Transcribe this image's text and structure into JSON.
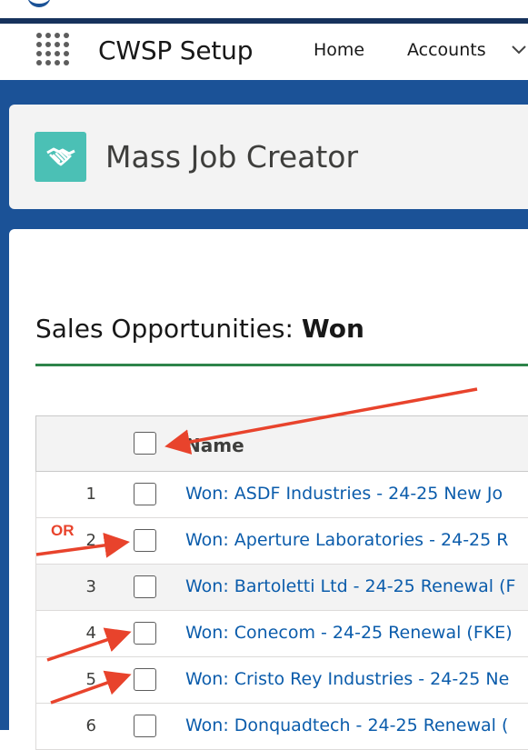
{
  "navbar": {
    "app_name": "CWSP Setup",
    "items": [
      {
        "label": "Home"
      },
      {
        "label": "Accounts"
      }
    ]
  },
  "header": {
    "title": "Mass Job Creator",
    "icon": "handshake-icon",
    "icon_color": "#4bc0b5"
  },
  "section": {
    "title_prefix": "Sales Opportunities:",
    "title_bold": "Won"
  },
  "table": {
    "column_name": "Name",
    "rows": [
      {
        "num": "1",
        "name": "Won: ASDF Industries - 24-25 New Jo"
      },
      {
        "num": "2",
        "name": "Won: Aperture Laboratories - 24-25 R"
      },
      {
        "num": "3",
        "name": "Won: Bartoletti Ltd - 24-25 Renewal (F"
      },
      {
        "num": "4",
        "name": "Won: Conecom - 24-25 Renewal (FKE)"
      },
      {
        "num": "5",
        "name": "Won: Cristo Rey Industries - 24-25 Ne"
      },
      {
        "num": "6",
        "name": "Won: Donquadtech - 24-25 Renewal ("
      }
    ]
  },
  "annotation": {
    "or_label": "OR",
    "arrow_color": "#e8432c"
  },
  "colors": {
    "brand_blue": "#1b5297",
    "link": "#0b5cab",
    "accent_green": "#2e844a"
  }
}
